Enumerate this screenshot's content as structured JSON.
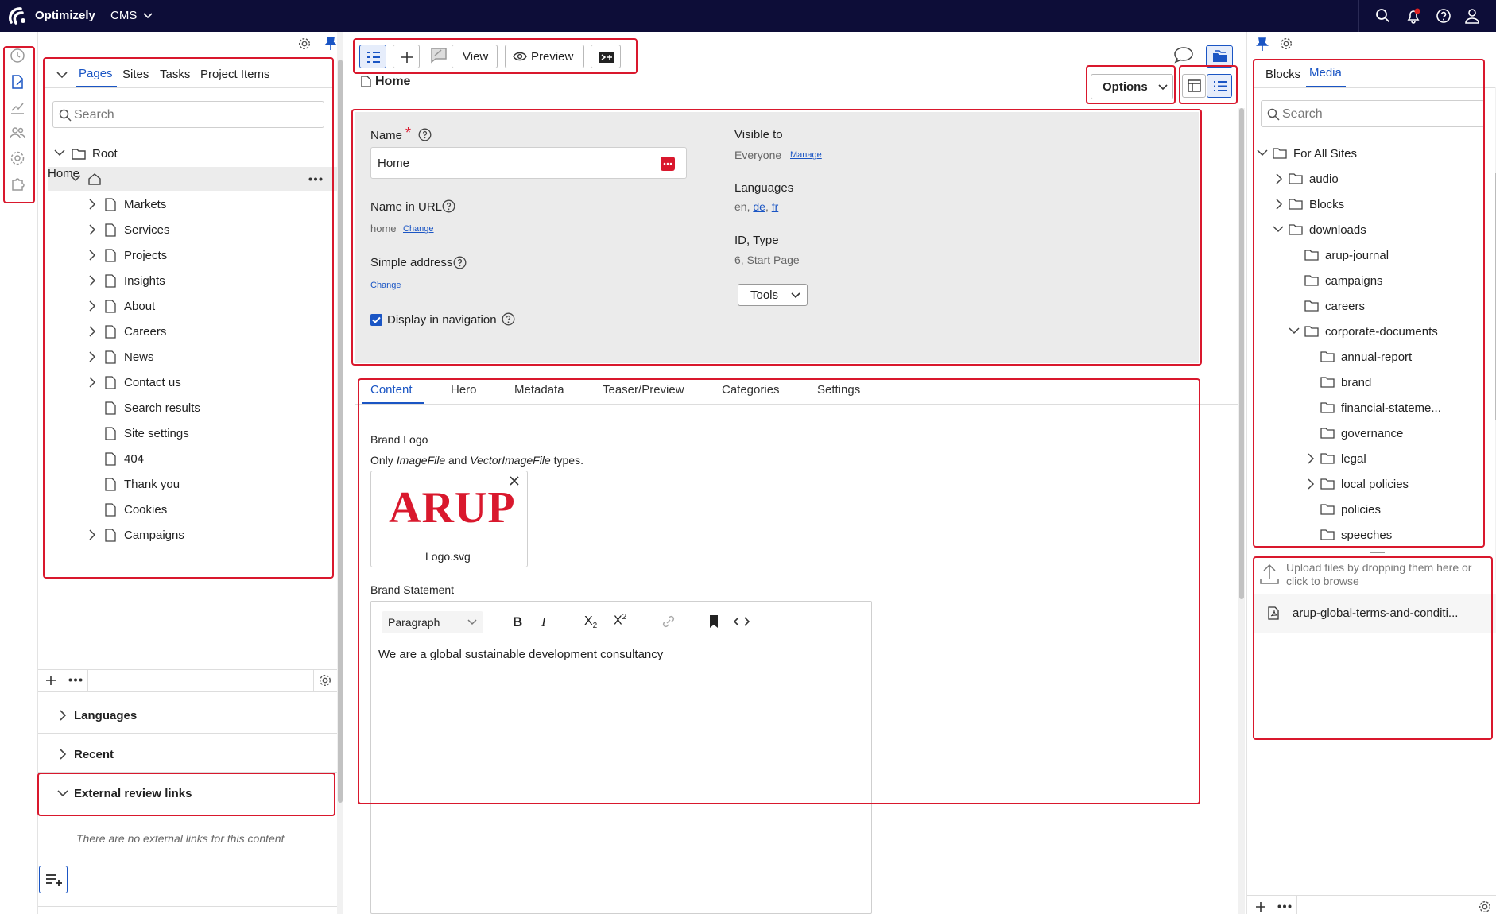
{
  "topbar": {
    "brand": "Optimizely",
    "app": "CMS"
  },
  "left": {
    "tabs": [
      "Pages",
      "Sites",
      "Tasks",
      "Project Items"
    ],
    "search_placeholder": "Search",
    "root": "Root",
    "home": "Home",
    "items": [
      "Markets",
      "Services",
      "Projects",
      "Insights",
      "About",
      "Careers",
      "News",
      "Contact us",
      "Search results",
      "Site settings",
      "404",
      "Thank you",
      "Cookies",
      "Campaigns"
    ],
    "languages": "Languages",
    "recent": "Recent",
    "external_review": "External review links",
    "no_links": "There are no external links for this content"
  },
  "toolbar": {
    "view": "View",
    "preview": "Preview",
    "options": "Options"
  },
  "page": {
    "title": "Home",
    "name_label": "Name",
    "required_mark": "*",
    "name_value": "Home",
    "name_in_url_label": "Name in URL",
    "url_value": "home",
    "change": "Change",
    "simple_address_label": "Simple address",
    "display_in_nav": "Display in navigation",
    "visible_to_label": "Visible to",
    "visible_to_value": "Everyone",
    "manage": "Manage",
    "languages_label": "Languages",
    "lang_en": "en,",
    "lang_de": "de",
    "lang_sep": ",",
    "lang_fr": "fr",
    "id_type_label": "ID, Type",
    "id_type_value": "6, Start Page",
    "tools": "Tools"
  },
  "content_tabs": [
    "Content",
    "Hero",
    "Metadata",
    "Teaser/Preview",
    "Categories",
    "Settings"
  ],
  "content": {
    "brand_logo_label": "Brand Logo",
    "brand_logo_help_prefix": "Only ",
    "brand_logo_help_type1": "ImageFile",
    "brand_logo_help_mid": " and ",
    "brand_logo_help_type2": "VectorImageFile",
    "brand_logo_help_suffix": " types.",
    "logo_text": "ARUP",
    "logo_file": "Logo.svg",
    "brand_statement_label": "Brand Statement",
    "format_select": "Paragraph",
    "statement_text": "We are a global sustainable development consultancy"
  },
  "right": {
    "tabs": [
      "Blocks",
      "Media"
    ],
    "search_placeholder": "Search",
    "root": "For All Sites",
    "folders": [
      "audio",
      "Blocks",
      "downloads",
      "arup-journal",
      "campaigns",
      "careers",
      "corporate-documents",
      "annual-report",
      "brand",
      "financial-stateme...",
      "governance",
      "legal",
      "local policies",
      "policies",
      "speeches"
    ],
    "upload_text": "Upload files by dropping them here or click to browse",
    "file": "arup-global-terms-and-conditi..."
  },
  "colors": {
    "topbar": "#0d0d38",
    "accent": "#1a55c4",
    "highlight": "#d9182d",
    "panel": "#ebebeb"
  }
}
